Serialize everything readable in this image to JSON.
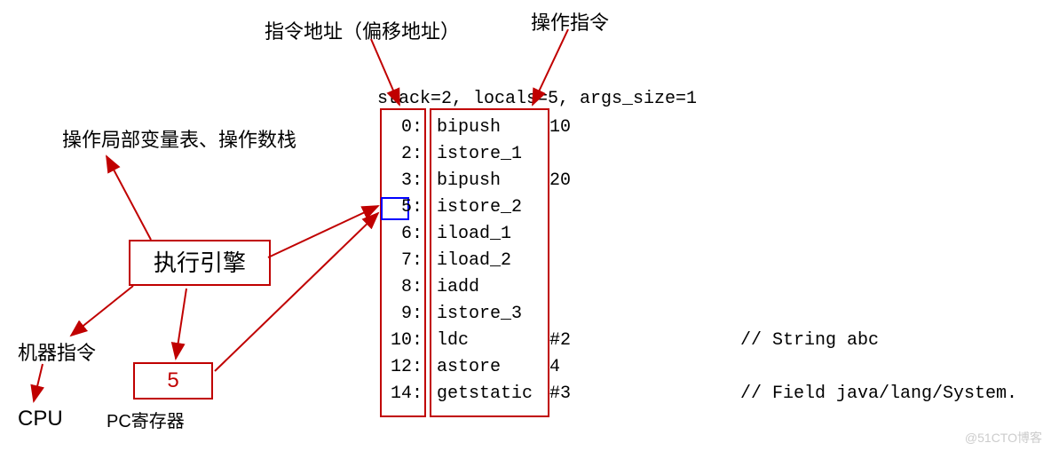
{
  "labels": {
    "addrLabel": "指令地址（偏移地址）",
    "opLabel": "操作指令",
    "stackLabel": "操作局部变量表、操作数栈",
    "engineLabel": "执行引擎",
    "machineLabel": "机器指令",
    "cpuLabel": "CPU",
    "pcLabel": "PC寄存器",
    "pcValue": "5",
    "watermark": "@51CTO博客"
  },
  "bytecodeHeader": "stack=2, locals=5, args_size=1",
  "instructions": [
    {
      "addr": "0:",
      "opcode": "bipush",
      "operand": "10",
      "comment": ""
    },
    {
      "addr": "2:",
      "opcode": "istore_1",
      "operand": "",
      "comment": ""
    },
    {
      "addr": "3:",
      "opcode": "bipush",
      "operand": "20",
      "comment": ""
    },
    {
      "addr": "5:",
      "opcode": "istore_2",
      "operand": "",
      "comment": ""
    },
    {
      "addr": "6:",
      "opcode": "iload_1",
      "operand": "",
      "comment": ""
    },
    {
      "addr": "7:",
      "opcode": "iload_2",
      "operand": "",
      "comment": ""
    },
    {
      "addr": "8:",
      "opcode": "iadd",
      "operand": "",
      "comment": ""
    },
    {
      "addr": "9:",
      "opcode": "istore_3",
      "operand": "",
      "comment": ""
    },
    {
      "addr": "10:",
      "opcode": "ldc",
      "operand": "#2",
      "comment": "// String abc"
    },
    {
      "addr": "12:",
      "opcode": "astore",
      "operand": "4",
      "comment": ""
    },
    {
      "addr": "14:",
      "opcode": "getstatic",
      "operand": "#3",
      "comment": "// Field java/lang/System."
    }
  ]
}
